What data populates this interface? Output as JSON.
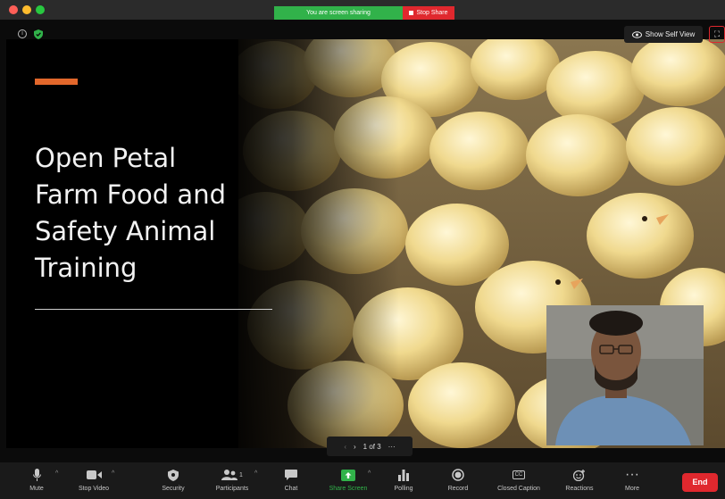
{
  "share_bar": {
    "sharing_text": "You are screen sharing",
    "stop_share_label": "Stop Share"
  },
  "header": {
    "info_icon_glyph": "i",
    "self_view_label": "Show Self View",
    "fullscreen_glyph": "⛶"
  },
  "slide": {
    "title_line1": "Open Petal",
    "title_line2": "Farm Food and",
    "title_line3": "Safety Animal",
    "title_line4": "Training",
    "accent_color": "#e2672b"
  },
  "pager": {
    "prev_glyph": "‹",
    "next_glyph": "›",
    "counter": "1 of 3",
    "more_glyph": "···"
  },
  "toolbar": {
    "mute_label": "Mute",
    "stop_video_label": "Stop Video",
    "security_label": "Security",
    "participants_label": "Participants",
    "participants_count": "1",
    "chat_label": "Chat",
    "share_screen_label": "Share Screen",
    "polling_label": "Polling",
    "record_label": "Record",
    "closed_caption_label": "Closed Caption",
    "reactions_label": "Reactions",
    "more_label": "More",
    "more_glyph": "···",
    "cc_glyph": "CC",
    "caret_glyph": "^",
    "end_label": "End"
  },
  "colors": {
    "share_green": "#31b24a",
    "end_red": "#e0282e"
  }
}
